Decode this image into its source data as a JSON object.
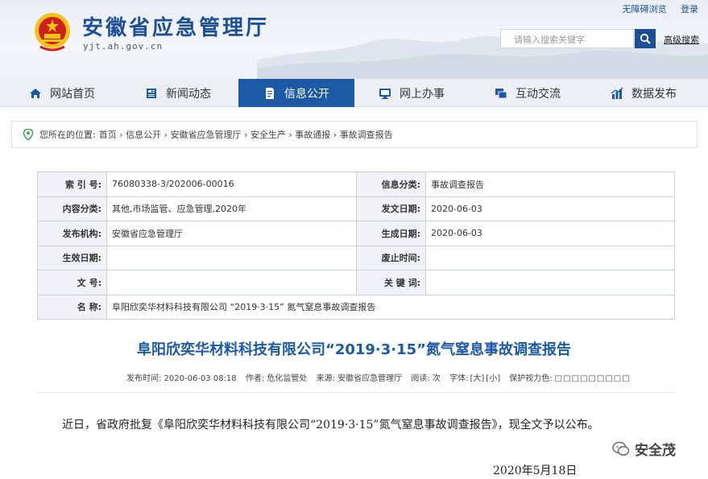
{
  "header": {
    "title": "安徽省应急管理厅",
    "domain": "yjt.ah.gov.cn",
    "top_links": [
      "无障碍浏览",
      "登录"
    ],
    "search_placeholder": "请输入搜索关键字",
    "advanced_search": "高级搜索"
  },
  "nav": {
    "items": [
      {
        "label": "网站首页",
        "icon": "home-icon"
      },
      {
        "label": "新闻动态",
        "icon": "news-icon"
      },
      {
        "label": "信息公开",
        "icon": "document-icon"
      },
      {
        "label": "网上办事",
        "icon": "monitor-icon"
      },
      {
        "label": "互动交流",
        "icon": "chat-icon"
      },
      {
        "label": "数据发布",
        "icon": "chart-icon"
      }
    ],
    "active_index": 2
  },
  "breadcrumb": {
    "prefix": "您所在的位置:",
    "path": "首页 › 信息公开 › 安徽省应急管理厅 › 安全生产 › 事故通报 › 事故调查报告"
  },
  "info": {
    "index_label": "索 引 号:",
    "index_value": "76080338-3/202006-00016",
    "category_label": "信息分类:",
    "category_value": "事故调查报告",
    "content_label": "内容分类:",
    "content_value": "其他,市场监管、应急管理,2020年",
    "issue_date_label": "发文日期:",
    "issue_date_value": "2020-06-03",
    "org_label": "发布机构:",
    "org_value": "安徽省应急管理厅",
    "gen_date_label": "生成日期:",
    "gen_date_value": "2020-06-03",
    "effective_label": "生效日期:",
    "effective_value": "",
    "abolish_label": "废止时间:",
    "abolish_value": "",
    "docno_label": "文 号:",
    "docno_value": "",
    "keywords_label": "关 键 词:",
    "keywords_value": "",
    "name_label": "名 称:",
    "name_value": "阜阳欣奕华材料科技有限公司 “2019·3·15” 氮气窒息事故调查报告"
  },
  "article": {
    "title": "阜阳欣奕华材料科技有限公司“2019·3·15”氮气窒息事故调查报告",
    "meta_time": "发布时间: 2020-06-03 08:18",
    "meta_author": "作者: 危化监管处",
    "meta_source": "来源: 安徽省应急管理厅",
    "meta_reads": "阅读: 次",
    "meta_font": "字体:",
    "font_large": "[大]",
    "font_small": "[小]",
    "meta_eye": "保护视力色:",
    "body": "近日，省政府批复《阜阳欣奕华材料科技有限公司“2019·3·15”氮气窒息事故调查报告》，现全文予以公布。",
    "date": "2020年5月18日"
  },
  "watermark": {
    "text": "安全茂"
  },
  "colors": {
    "brand": "#1c5aa6",
    "title": "#1c4f95",
    "emblem_red": "#d0201c",
    "emblem_gold": "#f2c318"
  }
}
